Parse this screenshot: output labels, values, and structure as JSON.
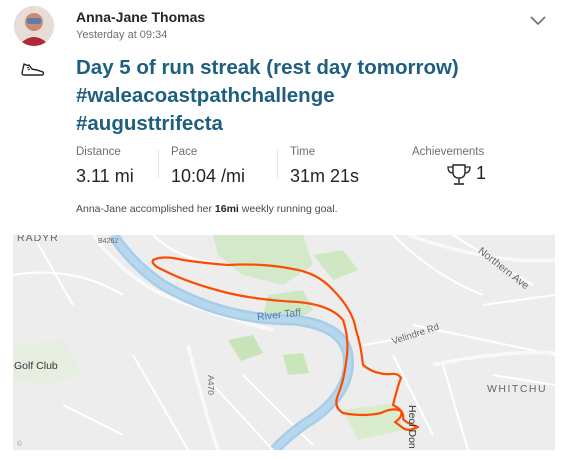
{
  "athlete": {
    "name": "Anna-Jane Thomas",
    "timestamp": "Yesterday at 09:34"
  },
  "activity": {
    "type_icon": "shoe-icon",
    "title_lines": [
      "Day 5 of run streak (rest day tomorrow)",
      "#waleacoastpathchallenge",
      "#augusttrifecta"
    ]
  },
  "stats": [
    {
      "label": "Distance",
      "value": "3.11 mi"
    },
    {
      "label": "Pace",
      "value": "10:04 /mi"
    },
    {
      "label": "Time",
      "value": "31m 21s"
    }
  ],
  "achievements": {
    "label": "Achievements",
    "count": "1",
    "icon": "trophy-icon"
  },
  "goal": {
    "prefix": "Anna-Jane accomplished her ",
    "amount": "16mi",
    "suffix": " weekly running goal."
  },
  "map": {
    "labels": {
      "radyr": "RADYR",
      "b4262": "B4262",
      "northern_ave": "Northern Ave",
      "river_taff": "River Taff",
      "velindre_rd": "Velindre Rd",
      "golf_club": "Golf Club",
      "a470": "A470",
      "heol_don": "Heol Don",
      "whitchurch": "WHITCHU"
    },
    "copyright": "©",
    "colors": {
      "route": "#fc4c02",
      "river": "#a8cde8",
      "park": "#cfe8c3"
    }
  },
  "colors": {
    "title": "#1e5f7f",
    "text": "#242428",
    "muted": "#6d6d78"
  }
}
